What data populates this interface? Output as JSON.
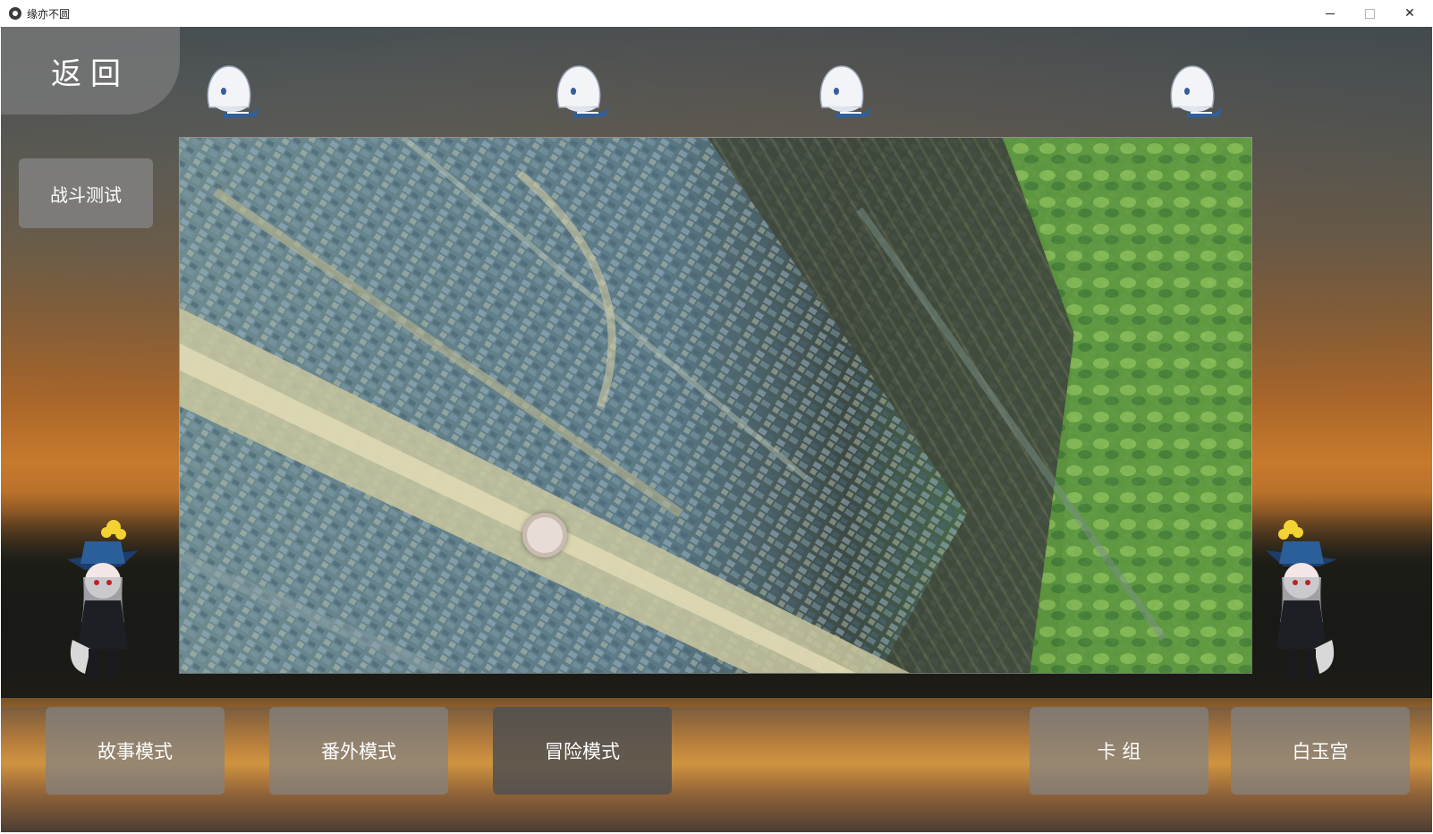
{
  "window": {
    "title": "缘亦不圆",
    "icon": "app-icon",
    "controls": [
      "minimize-icon",
      "maximize-icon",
      "close-icon"
    ],
    "close_glyph": "✕"
  },
  "nav": {
    "back_label": "返回",
    "battle_test_label": "战斗测试"
  },
  "map": {
    "marker": "map-position-marker"
  },
  "bottom_menu": {
    "items": [
      {
        "label": "故事模式",
        "active": false
      },
      {
        "label": "番外模式",
        "active": false
      },
      {
        "label": "冒险模式",
        "active": true
      },
      {
        "label": "卡 组",
        "active": false
      },
      {
        "label": "白玉宫",
        "active": false
      }
    ]
  },
  "colors": {
    "button_gray": "#828282",
    "button_active": "#505050",
    "sunset": "#c77a2c"
  }
}
